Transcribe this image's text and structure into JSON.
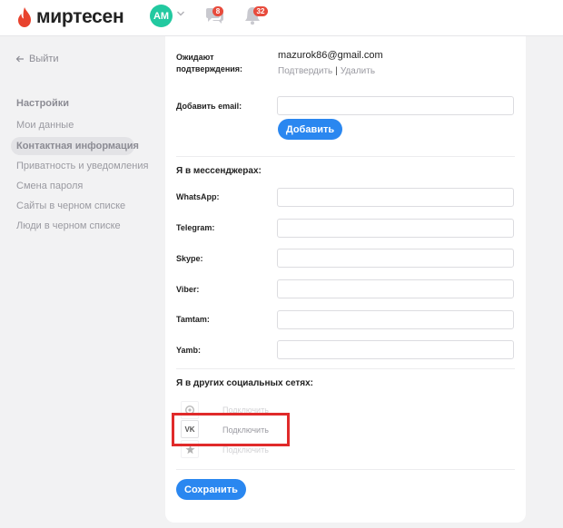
{
  "header": {
    "logo_text": "миртесен",
    "avatar_initials": "АМ",
    "messages_badge": "8",
    "notifications_badge": "32"
  },
  "sidebar": {
    "back_label": "Выйти",
    "title": "Настройки",
    "items": [
      {
        "label": "Мои данные",
        "active": false
      },
      {
        "label": "Контактная информация",
        "active": true
      },
      {
        "label": "Приватность и уведомления",
        "active": false
      },
      {
        "label": "Смена пароля",
        "active": false
      },
      {
        "label": "Сайты в черном списке",
        "active": false
      },
      {
        "label": "Люди в черном списке",
        "active": false
      }
    ]
  },
  "email": {
    "pending_label": "Ожидают подтверждения:",
    "pending_value": "mazurok86@gmail.com",
    "confirm_label": "Подтвердить",
    "separator": "|",
    "delete_label": "Удалить",
    "add_label": "Добавить email:",
    "add_button": "Добавить"
  },
  "messengers": {
    "title": "Я в мессенджерах:",
    "fields": [
      "WhatsApp:",
      "Telegram:",
      "Skype:",
      "Viber:",
      "Tamtam:",
      "Yamb:"
    ]
  },
  "socials": {
    "title": "Я в других социальных сетях:",
    "items": [
      {
        "icon": "odnoklassniki-icon",
        "label": "Подключить"
      },
      {
        "icon": "vk-icon",
        "glyph": "VK",
        "label": "Подключить"
      },
      {
        "icon": "star-icon",
        "label": "Подключить"
      }
    ]
  },
  "footer": {
    "save_button": "Сохранить"
  },
  "colors": {
    "accent": "#2a87f0",
    "brand_red": "#e8432e",
    "avatar": "#22c9a0",
    "highlight": "#e02a2a"
  }
}
